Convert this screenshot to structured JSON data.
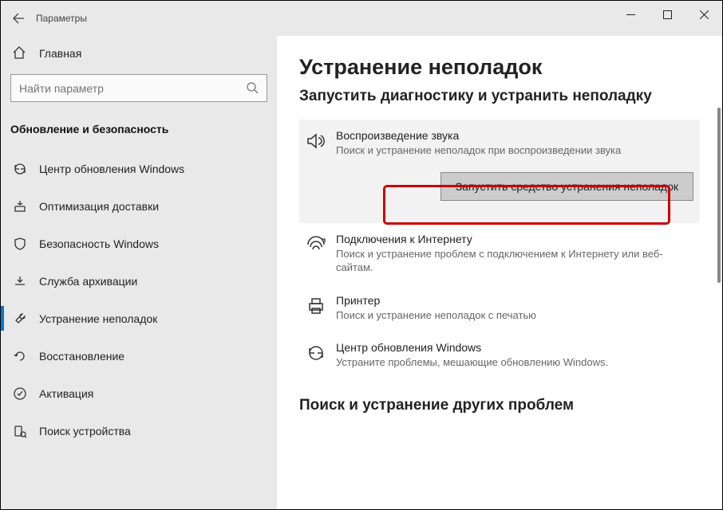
{
  "title": "Параметры",
  "home_label": "Главная",
  "search_placeholder": "Найти параметр",
  "category_header": "Обновление и безопасность",
  "sidebar": {
    "items": [
      {
        "label": "Центр обновления Windows"
      },
      {
        "label": "Оптимизация доставки"
      },
      {
        "label": "Безопасность Windows"
      },
      {
        "label": "Служба архивации"
      },
      {
        "label": "Устранение неполадок"
      },
      {
        "label": "Восстановление"
      },
      {
        "label": "Активация"
      },
      {
        "label": "Поиск устройства"
      }
    ]
  },
  "content": {
    "page_title": "Устранение неполадок",
    "page_subtitle": "Запустить диагностику и устранить неполадку",
    "run_button_label": "Запустить средство устранения неполадок",
    "section2_title": "Поиск и устранение других проблем",
    "items": [
      {
        "title": "Воспроизведение звука",
        "desc": "Поиск и устранение неполадок при воспроизведении звука"
      },
      {
        "title": "Подключения к Интернету",
        "desc": "Поиск и устранение проблем с подключением к Интернету или веб-сайтам."
      },
      {
        "title": "Принтер",
        "desc": "Поиск и устранение неполадок с печатью"
      },
      {
        "title": "Центр обновления Windows",
        "desc": "Устраните проблемы, мешающие обновлению Windows."
      }
    ]
  }
}
